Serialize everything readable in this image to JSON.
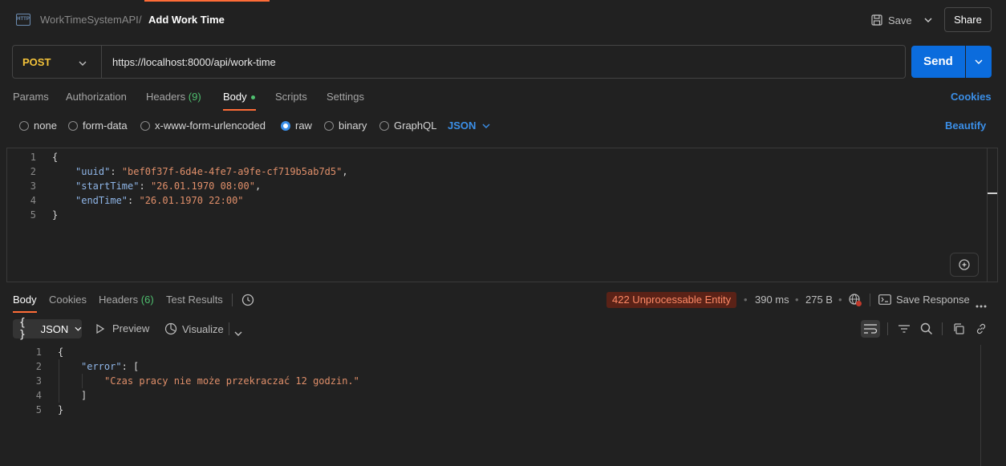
{
  "header": {
    "collection": "WorkTimeSystemAPI",
    "separator": "/",
    "request_name": "Add Work Time",
    "save_label": "Save",
    "share_label": "Share"
  },
  "request": {
    "method": "POST",
    "url": "https://localhost:8000/api/work-time",
    "send_label": "Send"
  },
  "request_tabs": {
    "params": "Params",
    "authorization": "Authorization",
    "headers": "Headers",
    "headers_count": "(9)",
    "body": "Body",
    "scripts": "Scripts",
    "settings": "Settings",
    "cookies": "Cookies"
  },
  "body_types": {
    "none": "none",
    "form_data": "form-data",
    "urlencoded": "x-www-form-urlencoded",
    "raw": "raw",
    "binary": "binary",
    "graphql": "GraphQL",
    "language": "JSON",
    "beautify": "Beautify"
  },
  "request_body": {
    "line_numbers": [
      "1",
      "2",
      "3",
      "4",
      "5"
    ],
    "open": "{",
    "close": "}",
    "fields": [
      {
        "key": "\"uuid\"",
        "value": "\"bef0f37f-6d4e-4fe7-a9fe-cf719b5ab7d5\"",
        "comma": ","
      },
      {
        "key": "\"startTime\"",
        "value": "\"26.01.1970 08:00\"",
        "comma": ","
      },
      {
        "key": "\"endTime\"",
        "value": "\"26.01.1970 22:00\"",
        "comma": ""
      }
    ]
  },
  "response_tabs": {
    "body": "Body",
    "cookies": "Cookies",
    "headers": "Headers",
    "headers_count": "(6)",
    "test_results": "Test Results"
  },
  "response_meta": {
    "status": "422 Unprocessable Entity",
    "time": "390 ms",
    "size": "275 B",
    "save_response": "Save Response",
    "dot": "•"
  },
  "response_toolbar": {
    "format_braces": "{ }",
    "format": "JSON",
    "preview": "Preview",
    "visualize": "Visualize"
  },
  "response_body": {
    "line_numbers": [
      "1",
      "2",
      "3",
      "4",
      "5"
    ],
    "open": "{",
    "key": "\"error\"",
    "colon": ": [",
    "message": "\"Czas pracy nie może przekraczać 12 godzin.\"",
    "array_close": "]",
    "close": "}"
  },
  "colors": {
    "accent": "#ff6c37",
    "send_blue": "#0b6cdd",
    "link_blue": "#3b8fe8",
    "method_yellow": "#f4c33a",
    "status_bg": "#5a2217",
    "status_text": "#ff8a66"
  }
}
